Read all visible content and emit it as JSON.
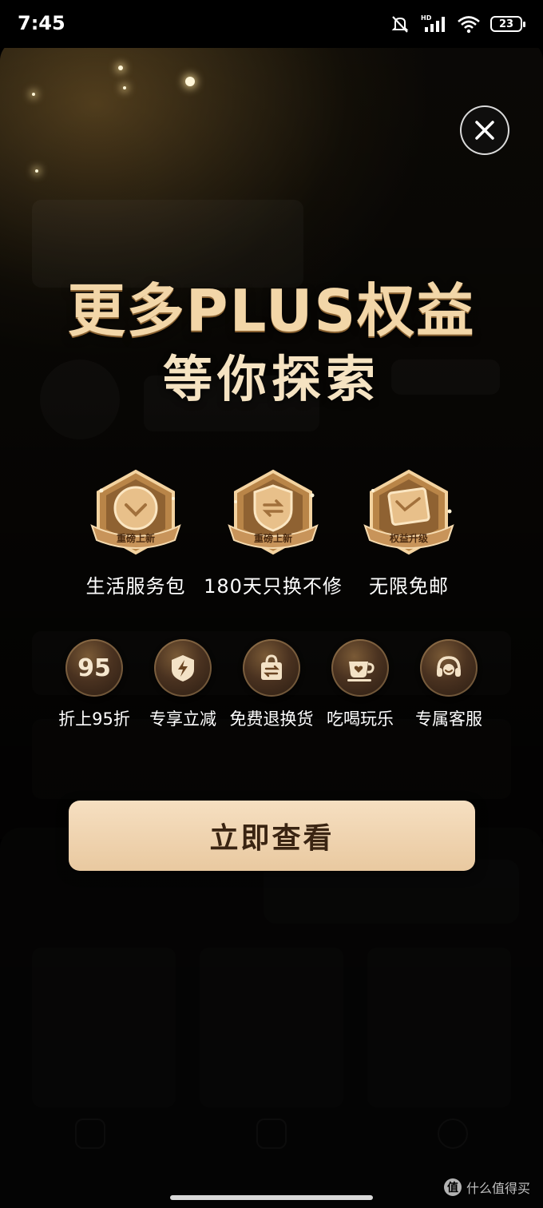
{
  "status_bar": {
    "time": "7:45",
    "network": "HD",
    "battery": "23"
  },
  "modal": {
    "title_line1": "更多PLUS权益",
    "title_line2": "等你探索",
    "featured": [
      {
        "label": "生活服务包",
        "ribbon": "重磅上新",
        "icon": "coin-icon"
      },
      {
        "label": "180天只换不修",
        "ribbon": "重磅上新",
        "icon": "shield-icon"
      },
      {
        "label": "无限免邮",
        "ribbon": "权益升级",
        "icon": "package-icon"
      }
    ],
    "perks": [
      {
        "label": "折上95折",
        "badge_text": "95",
        "icon": "discount-95-icon"
      },
      {
        "label": "专享立减",
        "icon": "lightning-shield-icon"
      },
      {
        "label": "免费退换货",
        "icon": "shopping-bag-icon"
      },
      {
        "label": "吃喝玩乐",
        "icon": "coffee-cup-icon"
      },
      {
        "label": "专属客服",
        "icon": "headset-icon"
      }
    ],
    "cta_label": "立即查看"
  },
  "watermark": "什么值得买",
  "colors": {
    "gold_title": "#f2d6a8",
    "cta_bg": "#f0d4b0",
    "cta_text": "#3a2412"
  }
}
